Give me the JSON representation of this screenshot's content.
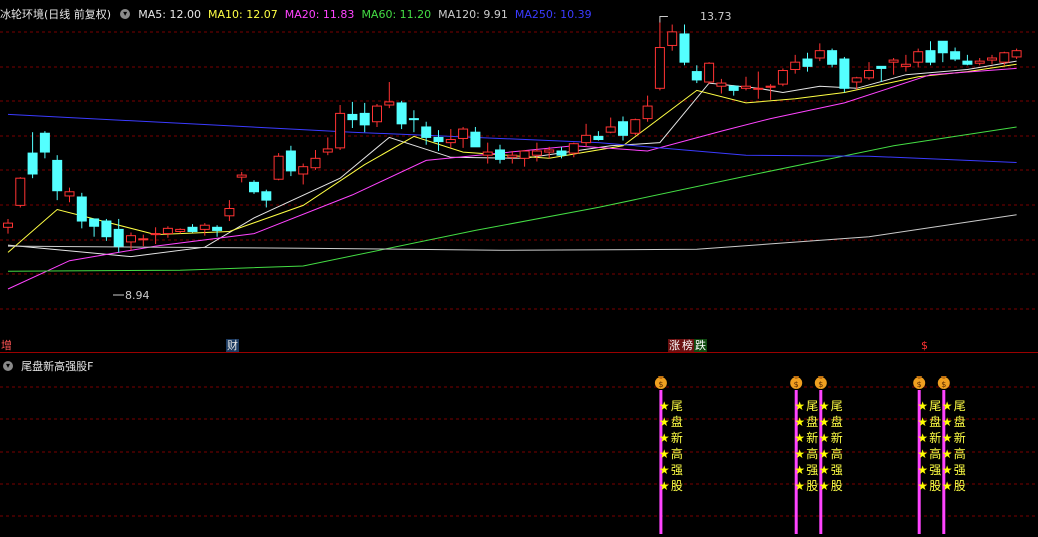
{
  "main_panel": {
    "title": "冰轮环境(日线 前复权)",
    "ma_labels": [
      {
        "text": "MA5: 12.00",
        "color": "#e6e6e6"
      },
      {
        "text": "MA10: 12.07",
        "color": "#ffff44"
      },
      {
        "text": "MA20: 11.83",
        "color": "#ff44ff"
      },
      {
        "text": "MA60: 11.20",
        "color": "#44dd44"
      },
      {
        "text": "MA120: 9.91",
        "color": "#cccccc"
      },
      {
        "text": "MA250: 10.39",
        "color": "#3b3bff"
      }
    ],
    "annotations": {
      "high": "13.73",
      "low": "8.94"
    },
    "event_markers": [
      {
        "text": "增",
        "bg": "#000",
        "fg": "#ff5555"
      },
      {
        "text": "财",
        "bg": "#1c3a60",
        "fg": "#e6e6e6"
      },
      {
        "text": "涨",
        "bg": "#6a1010",
        "fg": "#ffffff"
      },
      {
        "text": "榜",
        "bg": "#6a1010",
        "fg": "#ffffff"
      },
      {
        "text": "跌",
        "bg": "#104a10",
        "fg": "#ffffff"
      },
      {
        "text": "$",
        "bg": "#000",
        "fg": "#ff3333"
      }
    ]
  },
  "sub_panel": {
    "title": "尾盘新高强股F",
    "signal_icon": "money-bag-icon",
    "signal_chars": [
      "尾",
      "盘",
      "新",
      "高",
      "强",
      "股"
    ],
    "star_icon": "star-icon"
  },
  "colors": {
    "up": "#ff3333",
    "down": "#54ffff",
    "ma5": "#e6e6e6",
    "ma10": "#ffff44",
    "ma20": "#ff44ff",
    "ma60": "#44dd44",
    "ma120": "#cccccc",
    "ma250": "#3b3bff",
    "signal_bar": "#ff44ff",
    "grid": "#7a0000",
    "divider": "#9a0000"
  },
  "chart_data": {
    "type": "candlestick",
    "title": "冰轮环境(日线 前复权)",
    "price_range": [
      8.2,
      14.4
    ],
    "candles": [
      [
        10.28,
        10.44,
        10.16,
        10.36
      ],
      [
        10.7,
        11.24,
        10.66,
        11.22
      ],
      [
        11.7,
        12.1,
        11.22,
        11.3
      ],
      [
        12.08,
        12.12,
        11.6,
        11.72
      ],
      [
        11.56,
        11.66,
        10.8,
        10.98
      ],
      [
        10.88,
        11.04,
        10.76,
        10.96
      ],
      [
        10.86,
        10.94,
        10.26,
        10.4
      ],
      [
        10.44,
        10.44,
        10.1,
        10.3
      ],
      [
        10.4,
        10.44,
        10.02,
        10.1
      ],
      [
        10.24,
        10.44,
        9.8,
        9.92
      ],
      [
        10.0,
        10.18,
        9.84,
        10.12
      ],
      [
        10.06,
        10.14,
        9.92,
        10.06
      ],
      [
        10.14,
        10.28,
        9.96,
        10.16
      ],
      [
        10.16,
        10.3,
        10.08,
        10.26
      ],
      [
        10.2,
        10.26,
        10.16,
        10.24
      ],
      [
        10.28,
        10.34,
        10.18,
        10.2
      ],
      [
        10.24,
        10.36,
        10.12,
        10.32
      ],
      [
        10.28,
        10.32,
        10.1,
        10.22
      ],
      [
        10.5,
        10.8,
        10.4,
        10.64
      ],
      [
        11.24,
        11.34,
        11.14,
        11.28
      ],
      [
        11.14,
        11.18,
        10.92,
        10.96
      ],
      [
        10.96,
        11.0,
        10.66,
        10.8
      ],
      [
        11.2,
        11.7,
        11.18,
        11.64
      ],
      [
        11.74,
        11.84,
        11.26,
        11.36
      ],
      [
        11.3,
        11.5,
        11.1,
        11.44
      ],
      [
        11.42,
        11.76,
        11.38,
        11.6
      ],
      [
        11.72,
        12.0,
        11.66,
        11.78
      ],
      [
        11.8,
        12.62,
        11.76,
        12.46
      ],
      [
        12.44,
        12.68,
        12.18,
        12.34
      ],
      [
        12.46,
        12.66,
        12.1,
        12.24
      ],
      [
        12.3,
        12.64,
        12.2,
        12.6
      ],
      [
        12.62,
        13.06,
        12.56,
        12.68
      ],
      [
        12.66,
        12.7,
        12.16,
        12.26
      ],
      [
        12.36,
        12.52,
        12.1,
        12.34
      ],
      [
        12.2,
        12.3,
        11.86,
        12.0
      ],
      [
        12.0,
        12.14,
        11.74,
        11.92
      ],
      [
        11.9,
        12.16,
        11.8,
        11.96
      ],
      [
        11.98,
        12.2,
        11.8,
        12.16
      ],
      [
        12.1,
        12.2,
        11.82,
        11.82
      ],
      [
        11.66,
        11.9,
        11.5,
        11.72
      ],
      [
        11.76,
        11.86,
        11.5,
        11.58
      ],
      [
        11.62,
        11.74,
        11.5,
        11.66
      ],
      [
        11.6,
        11.76,
        11.44,
        11.74
      ],
      [
        11.66,
        11.9,
        11.54,
        11.74
      ],
      [
        11.72,
        11.82,
        11.6,
        11.76
      ],
      [
        11.74,
        11.82,
        11.6,
        11.66
      ],
      [
        11.7,
        11.9,
        11.62,
        11.88
      ],
      [
        11.9,
        12.26,
        11.82,
        12.04
      ],
      [
        12.02,
        12.12,
        11.94,
        11.96
      ],
      [
        12.1,
        12.38,
        12.08,
        12.2
      ],
      [
        12.3,
        12.4,
        11.94,
        12.04
      ],
      [
        12.08,
        12.36,
        12.04,
        12.34
      ],
      [
        12.36,
        12.8,
        12.3,
        12.6
      ],
      [
        12.94,
        14.2,
        12.9,
        13.72
      ],
      [
        13.76,
        14.16,
        13.66,
        14.02
      ],
      [
        13.98,
        14.16,
        13.38,
        13.44
      ],
      [
        13.26,
        13.38,
        13.04,
        13.1
      ],
      [
        13.06,
        13.44,
        13.02,
        13.42
      ],
      [
        12.98,
        13.12,
        12.84,
        13.04
      ],
      [
        12.98,
        13.0,
        12.8,
        12.9
      ],
      [
        12.94,
        13.16,
        12.9,
        12.98
      ],
      [
        12.94,
        13.26,
        12.74,
        12.94
      ],
      [
        12.96,
        13.02,
        12.72,
        12.98
      ],
      [
        13.02,
        13.32,
        12.98,
        13.28
      ],
      [
        13.3,
        13.58,
        13.22,
        13.44
      ],
      [
        13.5,
        13.62,
        13.26,
        13.36
      ],
      [
        13.52,
        13.8,
        13.46,
        13.66
      ],
      [
        13.66,
        13.7,
        13.34,
        13.4
      ],
      [
        13.5,
        13.54,
        12.86,
        12.94
      ],
      [
        13.06,
        13.16,
        12.92,
        13.14
      ],
      [
        13.14,
        13.44,
        13.1,
        13.28
      ],
      [
        13.36,
        13.36,
        13.06,
        13.32
      ],
      [
        13.44,
        13.52,
        13.2,
        13.48
      ],
      [
        13.36,
        13.58,
        13.26,
        13.4
      ],
      [
        13.44,
        13.7,
        13.34,
        13.64
      ],
      [
        13.66,
        13.84,
        13.38,
        13.44
      ],
      [
        13.84,
        13.84,
        13.44,
        13.62
      ],
      [
        13.64,
        13.72,
        13.46,
        13.5
      ],
      [
        13.46,
        13.58,
        13.38,
        13.4
      ],
      [
        13.42,
        13.52,
        13.38,
        13.46
      ],
      [
        13.48,
        13.58,
        13.4,
        13.52
      ],
      [
        13.44,
        13.64,
        13.38,
        13.62
      ],
      [
        13.54,
        13.7,
        13.5,
        13.66
      ]
    ],
    "ma": {
      "MA5": [
        [
          0,
          9.94
        ],
        [
          10,
          9.72
        ],
        [
          16,
          9.9
        ],
        [
          20,
          10.46
        ],
        [
          27,
          11.22
        ],
        [
          31,
          12.0
        ],
        [
          36,
          11.62
        ],
        [
          42,
          11.6
        ],
        [
          49,
          11.84
        ],
        [
          53,
          11.9
        ],
        [
          57,
          13.04
        ],
        [
          61,
          12.94
        ],
        [
          63,
          12.86
        ],
        [
          66,
          12.98
        ],
        [
          69,
          12.94
        ],
        [
          73,
          13.2
        ],
        [
          78,
          13.3
        ],
        [
          82,
          13.46
        ]
      ],
      "MA10": [
        [
          0,
          9.8
        ],
        [
          4,
          10.62
        ],
        [
          12,
          10.14
        ],
        [
          18,
          10.2
        ],
        [
          24,
          10.7
        ],
        [
          29,
          11.48
        ],
        [
          33,
          12.02
        ],
        [
          37,
          11.72
        ],
        [
          44,
          11.6
        ],
        [
          50,
          11.84
        ],
        [
          56,
          12.9
        ],
        [
          60,
          12.66
        ],
        [
          64,
          12.74
        ],
        [
          68,
          12.86
        ],
        [
          74,
          13.16
        ],
        [
          78,
          13.26
        ],
        [
          82,
          13.4
        ]
      ],
      "MA20": [
        [
          0,
          9.1
        ],
        [
          5,
          9.64
        ],
        [
          12,
          9.92
        ],
        [
          20,
          10.16
        ],
        [
          28,
          10.9
        ],
        [
          34,
          11.56
        ],
        [
          40,
          11.7
        ],
        [
          46,
          11.84
        ],
        [
          52,
          11.74
        ],
        [
          58,
          12.12
        ],
        [
          62,
          12.36
        ],
        [
          68,
          12.66
        ],
        [
          75,
          13.2
        ],
        [
          82,
          13.32
        ]
      ],
      "MA60": [
        [
          0,
          9.44
        ],
        [
          14,
          9.46
        ],
        [
          24,
          9.54
        ],
        [
          38,
          10.22
        ],
        [
          48,
          10.66
        ],
        [
          60,
          11.26
        ],
        [
          72,
          11.84
        ],
        [
          82,
          12.2
        ]
      ],
      "MA120": [
        [
          0,
          9.92
        ],
        [
          24,
          9.88
        ],
        [
          40,
          9.84
        ],
        [
          56,
          9.86
        ],
        [
          70,
          10.1
        ],
        [
          82,
          10.52
        ]
      ],
      "MA250": [
        [
          0,
          12.44
        ],
        [
          28,
          12.1
        ],
        [
          48,
          11.9
        ],
        [
          60,
          11.66
        ],
        [
          70,
          11.64
        ],
        [
          82,
          11.52
        ]
      ]
    },
    "signal_days": [
      53,
      64,
      66,
      74,
      76
    ]
  }
}
